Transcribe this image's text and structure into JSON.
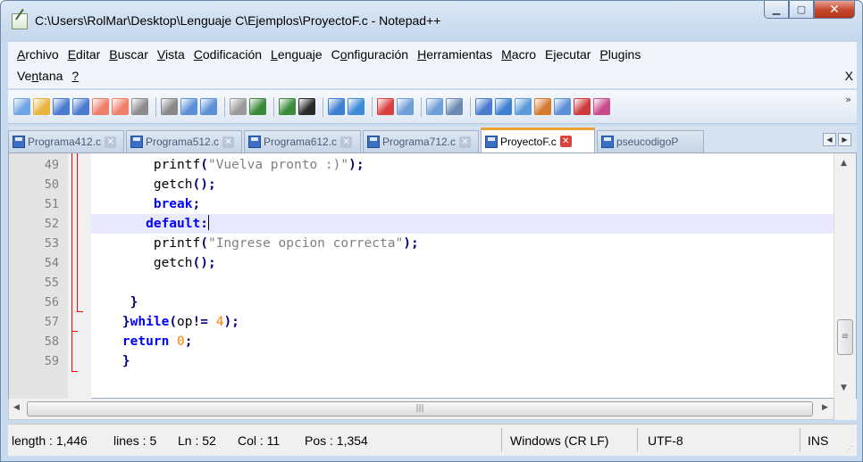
{
  "window": {
    "title": "C:\\Users\\RolMar\\Desktop\\Lenguaje C\\Ejemplos\\ProyectoF.c - Notepad++",
    "controls": [
      "minimize",
      "maximize",
      "close"
    ]
  },
  "menu": {
    "row1": [
      {
        "label": "Archivo",
        "mnemonic": "A"
      },
      {
        "label": "Editar",
        "mnemonic": "E"
      },
      {
        "label": "Buscar",
        "mnemonic": "B"
      },
      {
        "label": "Vista",
        "mnemonic": "V"
      },
      {
        "label": "Codificación",
        "mnemonic": "C"
      },
      {
        "label": "Lenguaje",
        "mnemonic": "L"
      },
      {
        "label": "Configuración",
        "mnemonic": "o"
      },
      {
        "label": "Herramientas",
        "mnemonic": "H"
      },
      {
        "label": "Macro",
        "mnemonic": "M"
      },
      {
        "label": "Ejecutar",
        "mnemonic": "j"
      },
      {
        "label": "Plugins",
        "mnemonic": "P"
      }
    ],
    "row2": [
      {
        "label": "Ventana",
        "mnemonic": "n"
      },
      {
        "label": "?",
        "mnemonic": "?"
      }
    ],
    "close_label": "X"
  },
  "toolbar": {
    "icons": [
      "new-icon",
      "open-icon",
      "save-icon",
      "save-all-icon",
      "close-icon",
      "close-all-icon",
      "print-icon",
      "|",
      "cut-icon",
      "copy-icon",
      "paste-icon",
      "|",
      "undo-icon",
      "redo-icon",
      "|",
      "find-icon",
      "replace-icon",
      "|",
      "zoom-in-icon",
      "zoom-out-icon",
      "|",
      "sync-v-icon",
      "sync-h-icon",
      "|",
      "word-wrap-icon",
      "show-all-chars-icon",
      "|",
      "indent-guide-icon",
      "user-lang-icon",
      "doc-map-icon",
      "function-list-icon",
      "folder-workspace-icon",
      "monitor-icon",
      "eye-icon"
    ],
    "icon_colors": [
      "#6ea5e6",
      "#e8b43c",
      "#4a7bd1",
      "#4a7bd1",
      "#f07f6a",
      "#f07f6a",
      "#8c8c8c",
      "#888888",
      "#5b8fd6",
      "#5b8fd6",
      "#9a9a9a",
      "#3a8a3a",
      "#3a8a3a",
      "#2a2a2a",
      "#3d7fd1",
      "#3d8ad6",
      "#d93f3f",
      "#6e9fd8",
      "#6e9fd8",
      "#6b8ab2",
      "#4a7bd1",
      "#3d7fd1",
      "#5a9ad6",
      "#d47a30",
      "#5b8fd6",
      "#cc3a3a",
      "#c94a8a",
      "#888888"
    ],
    "overflow_label": "»"
  },
  "tabs": [
    {
      "label": "Programa412.c",
      "active": false
    },
    {
      "label": "Programa512.c",
      "active": false
    },
    {
      "label": "Programa612.c",
      "active": false
    },
    {
      "label": "Programa712.c",
      "active": false
    },
    {
      "label": "ProyectoF.c",
      "active": true
    },
    {
      "label": "pseucodigoP",
      "active": false
    }
  ],
  "editor": {
    "current_line": 52,
    "lines": [
      {
        "n": "49",
        "tokens": [
          [
            "",
            "        "
          ],
          [
            "fn",
            "printf"
          ],
          [
            "op",
            "("
          ],
          [
            "str",
            "\"Vuelva pronto :)\""
          ],
          [
            "op",
            ");"
          ]
        ]
      },
      {
        "n": "50",
        "tokens": [
          [
            "",
            "        "
          ],
          [
            "fn",
            "getch"
          ],
          [
            "op",
            "();"
          ]
        ]
      },
      {
        "n": "51",
        "tokens": [
          [
            "",
            "        "
          ],
          [
            "kw",
            "break"
          ],
          [
            "op",
            ";"
          ]
        ]
      },
      {
        "n": "52",
        "tokens": [
          [
            "",
            "       "
          ],
          [
            "kw",
            "default"
          ],
          [
            "op",
            ":"
          ],
          [
            "caret",
            ""
          ]
        ]
      },
      {
        "n": "53",
        "tokens": [
          [
            "",
            "        "
          ],
          [
            "fn",
            "printf"
          ],
          [
            "op",
            "("
          ],
          [
            "str",
            "\"Ingrese opcion correcta\""
          ],
          [
            "op",
            ");"
          ]
        ]
      },
      {
        "n": "54",
        "tokens": [
          [
            "",
            "        "
          ],
          [
            "fn",
            "getch"
          ],
          [
            "op",
            "();"
          ]
        ]
      },
      {
        "n": "55",
        "tokens": []
      },
      {
        "n": "56",
        "tokens": [
          [
            "",
            "     "
          ],
          [
            "op",
            "}"
          ]
        ]
      },
      {
        "n": "57",
        "tokens": [
          [
            "",
            "    "
          ],
          [
            "op",
            "}"
          ],
          [
            "kw",
            "while"
          ],
          [
            "op",
            "("
          ],
          [
            "fn",
            "op"
          ],
          [
            "op",
            "!="
          ],
          [
            "",
            " "
          ],
          [
            "num",
            "4"
          ],
          [
            "op",
            ");"
          ]
        ]
      },
      {
        "n": "58",
        "tokens": [
          [
            "",
            "    "
          ],
          [
            "kw",
            "return"
          ],
          [
            "",
            " "
          ],
          [
            "num",
            "0"
          ],
          [
            "op",
            ";"
          ]
        ]
      },
      {
        "n": "59",
        "tokens": [
          [
            "",
            "    "
          ],
          [
            "op",
            "}"
          ]
        ]
      }
    ]
  },
  "status": {
    "length": "length : 1,446",
    "lines": "lines : 5",
    "ln": "Ln : 52",
    "col": "Col : 11",
    "pos": "Pos : 1,354",
    "eol": "Windows (CR LF)",
    "encoding": "UTF-8",
    "mode": "INS"
  }
}
